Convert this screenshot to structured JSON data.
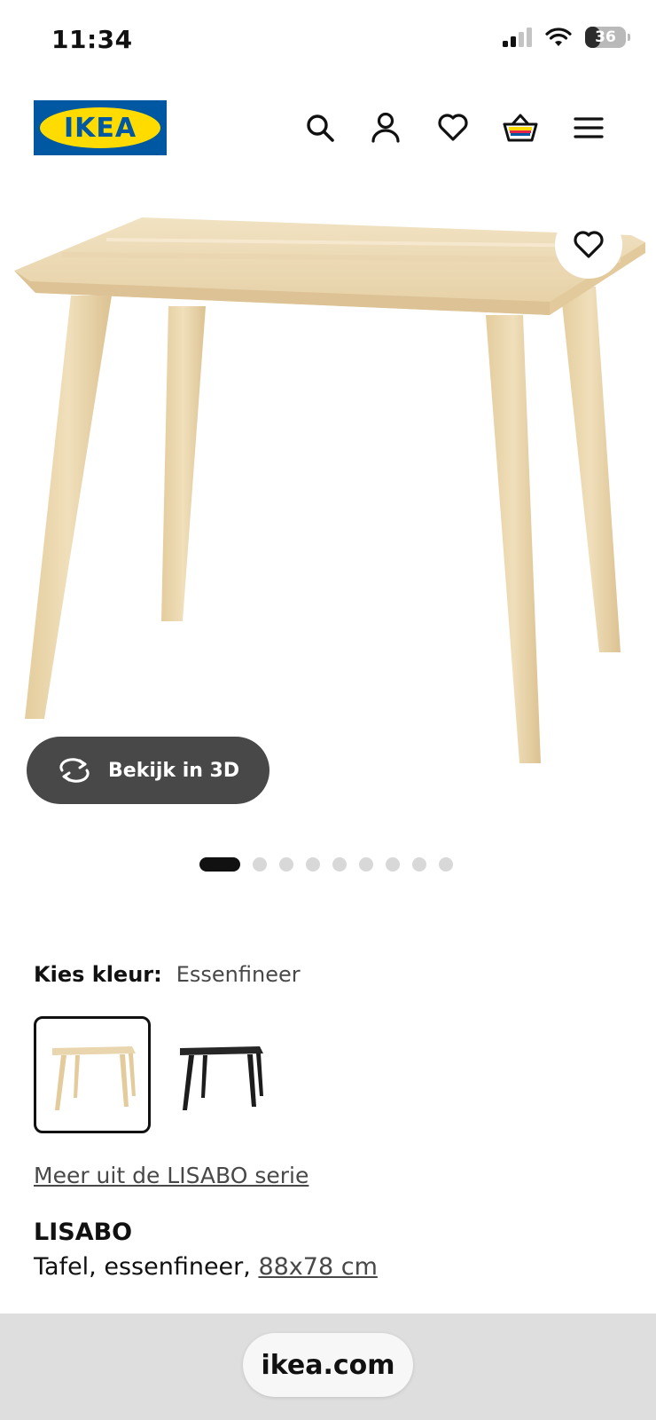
{
  "status_bar": {
    "time": "11:34",
    "battery": "36",
    "battery_level": 0.36
  },
  "header": {
    "logo_text": "IKEA",
    "icons": [
      "search-icon",
      "account-icon",
      "wishlist-icon",
      "cart-icon",
      "menu-icon"
    ]
  },
  "product_image": {
    "view_3d_label": "Bekijk in 3D",
    "favorite_icon": "heart-outline-icon",
    "dot_count": 9,
    "active_dot": 1
  },
  "color": {
    "label": "Kies kleur:",
    "selected": "Essenfineer",
    "swatches": [
      "ash-veneer",
      "black"
    ]
  },
  "series_link": "Meer uit de LISABO serie",
  "product": {
    "name": "LISABO",
    "description": "Tafel, essenfineer,",
    "size_link": "88x78 cm"
  },
  "browser": {
    "url": "ikea.com"
  },
  "colors": {
    "ikea_blue": "#0058a3",
    "ikea_yellow": "#ffdb00",
    "wood": "#e8d2a8",
    "dark_pill": "#484848"
  }
}
